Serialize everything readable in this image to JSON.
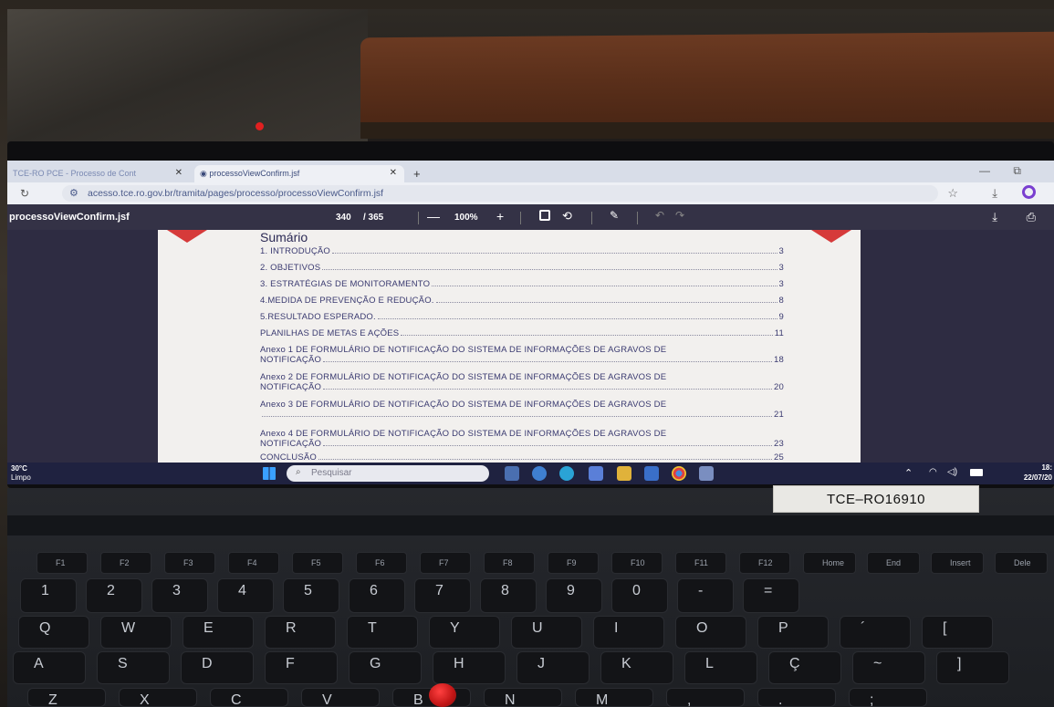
{
  "browser": {
    "tabs": [
      {
        "label": "TCE-RO PCE - Processo de Cont"
      },
      {
        "label": "processoViewConfirm.jsf"
      }
    ],
    "new_tab": "+",
    "url": "acesso.tce.ro.gov.br/tramita/pages/processo/processoViewConfirm.jsf"
  },
  "pdf_viewer": {
    "title": "processoViewConfirm.jsf",
    "page_current": "340",
    "page_total": "/ 365",
    "zoom": "100%",
    "zoom_out": "—",
    "zoom_in": "+"
  },
  "document": {
    "toc_title": "Sumário",
    "entries": [
      {
        "text": "1. INTRODUÇÃO",
        "page": "3"
      },
      {
        "text": "2. OBJETIVOS",
        "page": "3"
      },
      {
        "text": "3. ESTRATÉGIAS DE MONITORAMENTO",
        "page": "3"
      },
      {
        "text": "4.MEDIDA DE PREVENÇÃO E REDUÇÃO.",
        "page": "8"
      },
      {
        "text": "5.RESULTADO ESPERADO.",
        "page": "9"
      },
      {
        "text": "PLANILHAS DE METAS E AÇÕES",
        "page": "11"
      },
      {
        "text": "Anexo 1 DE FORMULÁRIO DE NOTIFICAÇÃO DO SISTEMA DE INFORMAÇÕES DE AGRAVOS DE",
        "cont": "NOTIFICAÇÃO",
        "page": "18"
      },
      {
        "text": "Anexo 2 DE FORMULÁRIO DE NOTIFICAÇÃO DO SISTEMA DE INFORMAÇÕES DE AGRAVOS DE",
        "cont": "NOTIFICAÇÃO",
        "page": "20"
      },
      {
        "text": "Anexo 3 DE FORMULÁRIO DE NOTIFICAÇÃO DO SISTEMA DE INFORMAÇÕES DE AGRAVOS DE",
        "cont": "",
        "page": "21"
      },
      {
        "text": "Anexo 4 DE FORMULÁRIO DE NOTIFICAÇÃO DO SISTEMA DE INFORMAÇÕES DE AGRAVOS DE",
        "cont": "NOTIFICAÇÃO",
        "page": "23"
      },
      {
        "text": "CONCLUSÃO",
        "page": "25"
      }
    ]
  },
  "taskbar": {
    "weather_temp": "30°C",
    "weather_cond": "Limpo",
    "search_placeholder": "Pesquisar",
    "clock_time": "18:",
    "clock_date": "22/07/20",
    "icons": [
      "start-icon",
      "folder-icon",
      "edge-icon",
      "chrome-icon",
      "store-icon",
      "app-icon"
    ]
  },
  "asset_tag": "TCE–RO16910",
  "keyboard": {
    "fkeys": [
      {
        "label": "F1"
      },
      {
        "label": "F2"
      },
      {
        "label": "F3"
      },
      {
        "label": "F4"
      },
      {
        "label": "F5"
      },
      {
        "label": "F6"
      },
      {
        "label": "F7"
      },
      {
        "label": "F8"
      },
      {
        "label": "F9"
      },
      {
        "label": "F10"
      },
      {
        "label": "F11"
      },
      {
        "label": "F12"
      },
      {
        "label": "Home"
      },
      {
        "label": "End"
      },
      {
        "label": "Insert"
      },
      {
        "label": "Dele"
      }
    ],
    "row_numbers": [
      "1",
      "2",
      "3",
      "4",
      "5",
      "6",
      "7",
      "8",
      "9",
      "0",
      "-",
      "="
    ],
    "row_q": [
      "Q",
      "W",
      "E",
      "R",
      "T",
      "Y",
      "U",
      "I",
      "O",
      "P",
      "´",
      "["
    ],
    "row_a": [
      "A",
      "S",
      "D",
      "F",
      "G",
      "H",
      "J",
      "K",
      "L",
      "Ç",
      "~",
      "]"
    ],
    "row_z": [
      "Z",
      "X",
      "C",
      "V",
      "B",
      "N",
      "M",
      ",",
      ".",
      ";"
    ]
  },
  "colors": {
    "pdf_background": "#2e2c42",
    "page_background": "#f2f0ee",
    "accent_red": "#d63a3a",
    "taskbar": "#1f2240"
  }
}
